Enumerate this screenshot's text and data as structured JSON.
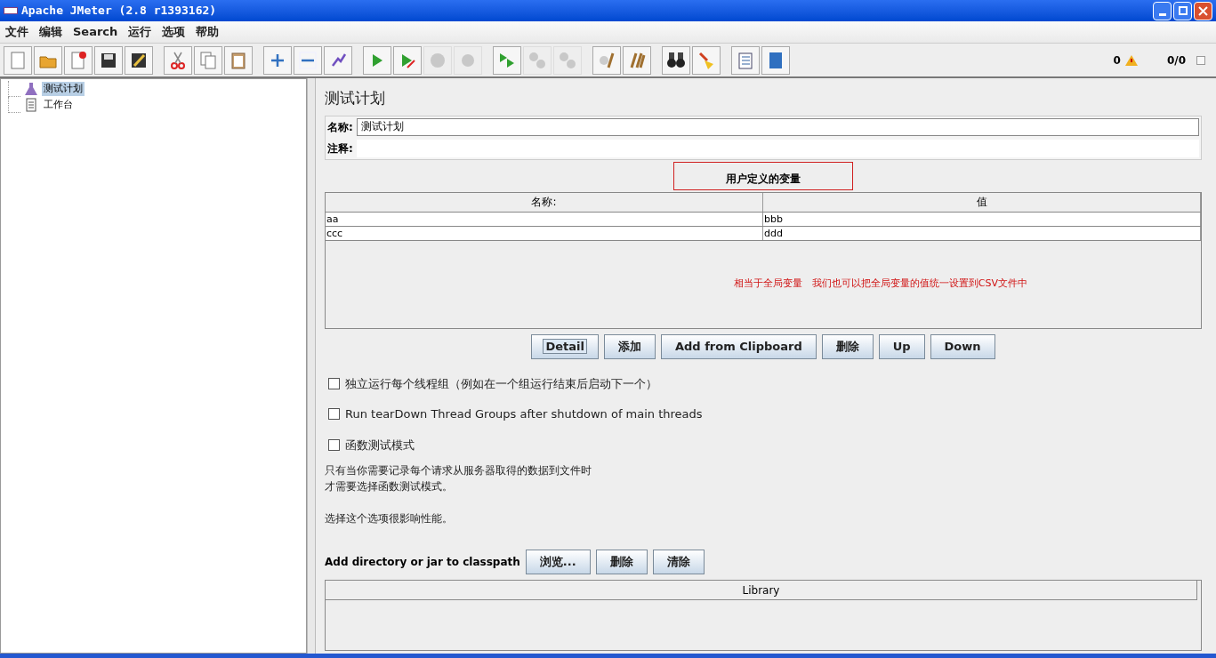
{
  "window": {
    "title": "Apache JMeter (2.8 r1393162)"
  },
  "menu": [
    "文件",
    "编辑",
    "Search",
    "运行",
    "选项",
    "帮助"
  ],
  "toolbar": [
    {
      "disabled": false
    },
    {
      "disabled": false
    },
    {
      "disabled": false
    },
    {
      "disabled": false
    },
    {
      "disabled": false
    },
    {
      "disabled": false
    },
    {
      "disabled": false
    },
    {
      "disabled": false
    },
    {
      "disabled": false
    },
    {
      "disabled": false
    },
    {
      "disabled": false
    },
    {
      "disabled": false
    },
    {
      "disabled": false
    },
    {
      "disabled": true
    },
    {
      "disabled": true
    },
    {
      "disabled": false
    },
    {
      "disabled": true
    },
    {
      "disabled": true
    },
    {
      "disabled": false
    },
    {
      "disabled": false
    },
    {
      "disabled": false
    },
    {
      "disabled": false
    },
    {
      "disabled": false
    },
    {
      "disabled": false
    }
  ],
  "status": {
    "warnings": "0",
    "threads": "0/0"
  },
  "tree": [
    {
      "label": "测试计划",
      "selected": true,
      "kind": "plan"
    },
    {
      "label": "工作台",
      "selected": false,
      "kind": "bench"
    }
  ],
  "panel": {
    "title": "测试计划",
    "name_label": "名称:",
    "name_value": "测试计划",
    "comment_label": "注释:",
    "variables_title": "用户定义的变量",
    "table": {
      "columns": [
        "名称:",
        "值"
      ],
      "rows": [
        [
          "aa",
          "bbb"
        ],
        [
          "ccc",
          "ddd"
        ]
      ]
    },
    "note": "相当于全局变量   我们也可以把全局变量的值统一设置到CSV文件中",
    "buttons": [
      {
        "label": "Detail",
        "focused": true
      },
      {
        "label": "添加",
        "focused": false
      },
      {
        "label": "Add from Clipboard",
        "focused": false
      },
      {
        "label": "删除",
        "focused": false
      },
      {
        "label": "Up",
        "focused": false
      },
      {
        "label": "Down",
        "focused": false
      }
    ],
    "options": [
      {
        "label": "独立运行每个线程组（例如在一个组运行结束后启动下一个）",
        "checked": false
      },
      {
        "label": "Run tearDown Thread Groups after shutdown of main threads",
        "checked": false
      },
      {
        "label": "函数测试模式",
        "checked": false
      }
    ],
    "help_lines": [
      "只有当你需要记录每个请求从服务器取得的数据到文件时",
      "才需要选择函数测试模式。",
      "选择这个选项很影响性能。"
    ],
    "classpath_label": "Add directory or jar to classpath",
    "classpath_buttons": [
      "浏览...",
      "删除",
      "清除"
    ],
    "library_column": "Library"
  }
}
